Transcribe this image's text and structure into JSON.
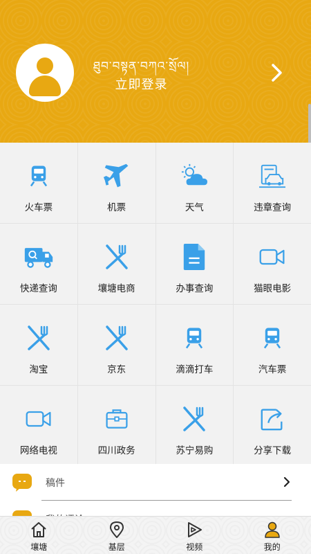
{
  "header": {
    "tibetan_text": "ཐུབ་བསྟན་བཀའ་སྲོལ།",
    "login_label": "立即登录"
  },
  "grid": [
    {
      "label": "火车票",
      "icon": "train-icon"
    },
    {
      "label": "机票",
      "icon": "airplane-icon"
    },
    {
      "label": "天气",
      "icon": "weather-icon"
    },
    {
      "label": "违章查询",
      "icon": "car-violation-icon"
    },
    {
      "label": "快递查询",
      "icon": "delivery-truck-icon"
    },
    {
      "label": "壤塘电商",
      "icon": "fork-knife-icon"
    },
    {
      "label": "办事查询",
      "icon": "document-icon"
    },
    {
      "label": "猫眼电影",
      "icon": "video-camera-icon"
    },
    {
      "label": "淘宝",
      "icon": "fork-knife-icon"
    },
    {
      "label": "京东",
      "icon": "fork-knife-icon"
    },
    {
      "label": "滴滴打车",
      "icon": "train-icon"
    },
    {
      "label": "汽车票",
      "icon": "train-icon"
    },
    {
      "label": "网络电视",
      "icon": "video-camera-icon"
    },
    {
      "label": "四川政务",
      "icon": "briefcase-icon"
    },
    {
      "label": "苏宁易购",
      "icon": "fork-knife-icon"
    },
    {
      "label": "分享下载",
      "icon": "share-icon"
    }
  ],
  "list": [
    {
      "label": "稿件",
      "icon": "chat-bubble-icon"
    },
    {
      "label": "我的评论",
      "icon": "chat-bubble-icon"
    }
  ],
  "tabbar": [
    {
      "label": "壤塘",
      "icon": "home-icon"
    },
    {
      "label": "基层",
      "icon": "location-pin-icon"
    },
    {
      "label": "视频",
      "icon": "play-icon"
    },
    {
      "label": "我的",
      "icon": "user-icon",
      "active": true
    }
  ],
  "colors": {
    "header_bg": "#e8a812",
    "icon_blue": "#3aa0e8",
    "accent_orange": "#e8a812"
  }
}
